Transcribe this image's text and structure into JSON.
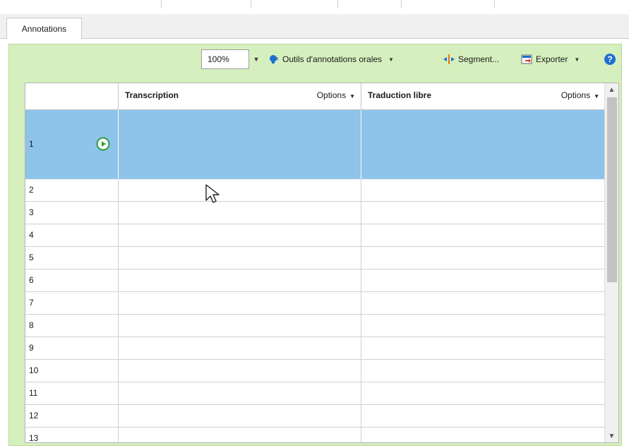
{
  "tabs": [
    {
      "label": "Annotations",
      "active": true
    }
  ],
  "toolbar": {
    "zoom_value": "100%",
    "oral_tools_label": "Outils d'annotations orales",
    "segment_label": "Segment...",
    "export_label": "Exporter"
  },
  "table": {
    "columns": [
      {
        "title": "",
        "options": ""
      },
      {
        "title": "Transcription",
        "options": "Options"
      },
      {
        "title": "Traduction libre",
        "options": "Options"
      }
    ],
    "rows": [
      {
        "num": "1",
        "transcription": "",
        "translation": "",
        "selected": true
      },
      {
        "num": "2",
        "transcription": "",
        "translation": ""
      },
      {
        "num": "3",
        "transcription": "",
        "translation": ""
      },
      {
        "num": "4",
        "transcription": "",
        "translation": ""
      },
      {
        "num": "5",
        "transcription": "",
        "translation": ""
      },
      {
        "num": "6",
        "transcription": "",
        "translation": ""
      },
      {
        "num": "7",
        "transcription": "",
        "translation": ""
      },
      {
        "num": "8",
        "transcription": "",
        "translation": ""
      },
      {
        "num": "9",
        "transcription": "",
        "translation": ""
      },
      {
        "num": "10",
        "transcription": "",
        "translation": ""
      },
      {
        "num": "11",
        "transcription": "",
        "translation": ""
      },
      {
        "num": "12",
        "transcription": "",
        "translation": ""
      },
      {
        "num": "13",
        "transcription": "",
        "translation": ""
      }
    ]
  },
  "icons": {
    "oral_tools": "speaking-head-icon",
    "segment": "segment-arrows-icon",
    "export": "export-document-icon",
    "help": "help-icon",
    "play": "play-circle-icon"
  },
  "colors": {
    "panel_bg": "#d6efbe",
    "selected_row": "#8fc3ea",
    "accent_blue": "#1e6fd0",
    "play_green": "#2e9e3c"
  }
}
